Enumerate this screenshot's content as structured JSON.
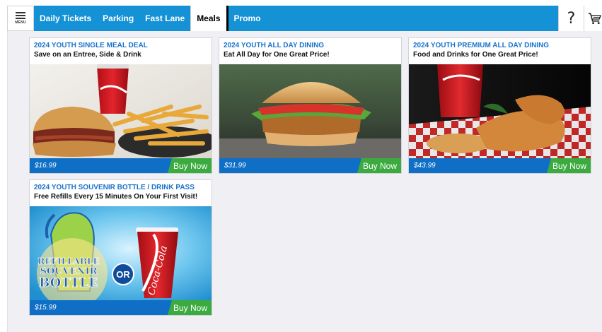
{
  "topbar": {
    "menu_label": "MENU",
    "tabs": [
      {
        "label": "Daily Tickets",
        "active": false
      },
      {
        "label": "Parking",
        "active": false
      },
      {
        "label": "Fast Lane",
        "active": false
      },
      {
        "label": "Meals",
        "active": true
      },
      {
        "label": "Promo",
        "active": false
      }
    ],
    "help_label": "?",
    "cart_icon": "cart-icon"
  },
  "colors": {
    "brand_blue": "#1592d6",
    "footer_blue": "#0f6fc6",
    "buy_green": "#3bab3f",
    "title_blue": "#1a73c9"
  },
  "cards": [
    {
      "title": "2024 YOUTH SINGLE MEAL DEAL",
      "subtitle": "Save on an Entree, Side & Drink",
      "price": "$16.99",
      "buy_label": "Buy Now"
    },
    {
      "title": "2024 YOUTH ALL DAY DINING",
      "subtitle": "Eat All Day for One Great Price!",
      "price": "$31.99",
      "buy_label": "Buy Now"
    },
    {
      "title": "2024 YOUTH PREMIUM ALL DAY DINING",
      "subtitle": "Food and Drinks for One Great Price!",
      "price": "$43.99",
      "buy_label": "Buy Now"
    },
    {
      "title": "2024 YOUTH SOUVENIR BOTTLE / DRINK PASS",
      "subtitle": "Free Refills Every 15 Minutes On Your First Visit!",
      "price": "$15.99",
      "buy_label": "Buy Now"
    }
  ],
  "bottle_art": {
    "line1": "REFILLABLE",
    "line2": "SOUVENIR",
    "line3": "BOTTLE",
    "or": "OR",
    "cup_brand": "Coca-Cola"
  }
}
